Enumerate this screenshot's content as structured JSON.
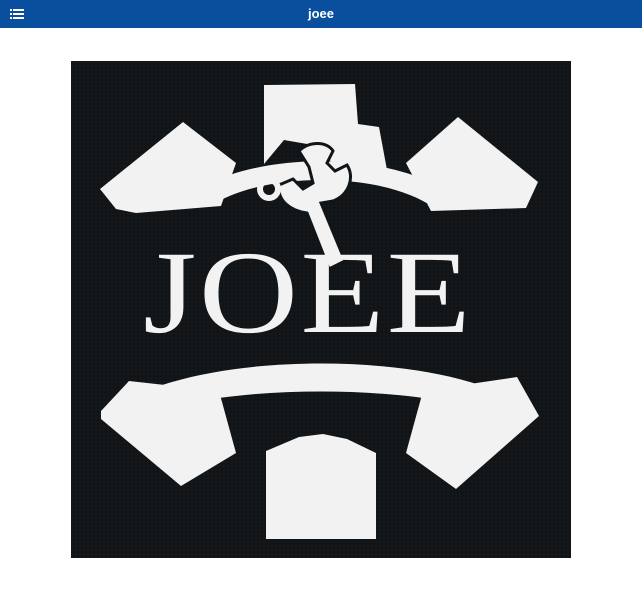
{
  "app_bar": {
    "title": "joee",
    "menu_icon": "list-icon",
    "background_color": "#0a4f9e",
    "text_color": "#ffffff"
  },
  "main": {
    "logo": {
      "wordmark": "JOEE",
      "icons": [
        "gear-icon",
        "wrench-icon"
      ],
      "foreground_color": "#f2f2f2",
      "background_color": "#111518"
    }
  }
}
